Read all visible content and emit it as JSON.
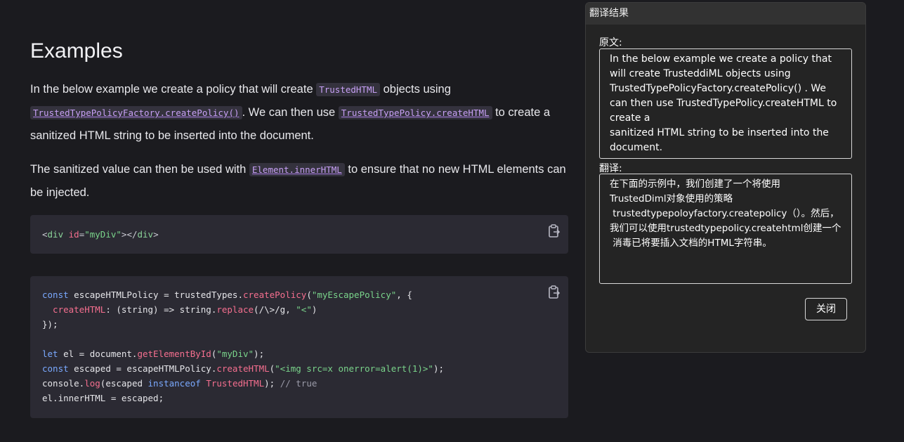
{
  "article": {
    "heading": "Examples",
    "para1": {
      "t1": "In the below example we create a policy that will create ",
      "c1": "TrustedHTML",
      "t2": " objects using ",
      "c2": "TrustedTypePolicyFactory.createPolicy()",
      "t3": ". We can then use ",
      "c3": "TrustedTypePolicy.createHTML",
      "t4": " to create a sanitized HTML string to be inserted into the document."
    },
    "para2": {
      "t1": "The sanitized value can then be used with ",
      "c1": "Element.innerHTML",
      "t2": " to ensure that no new HTML elements can be injected."
    },
    "code1": {
      "lt": "<",
      "tag": "div",
      "attr": "id",
      "eq": "=",
      "val": "\"myDiv\"",
      "close": "></",
      "tag2": "div",
      "gt": ">"
    },
    "code2": {
      "l1_kw": "const",
      "l1_a": " escapeHTMLPolicy = trustedTypes.",
      "l1_fn": "createPolicy",
      "l1_b": "(",
      "l1_str": "\"myEscapePolicy\"",
      "l1_c": ", {",
      "l2_fn": "  createHTML",
      "l2_a": ": (string) => string.",
      "l2_fn2": "replace",
      "l2_b": "(/\\>/g, ",
      "l2_str": "\"<\"",
      "l2_c": ")",
      "l3": "});",
      "l5_kw": "let",
      "l5_a": " el = document.",
      "l5_fn": "getElementById",
      "l5_b": "(",
      "l5_str": "\"myDiv\"",
      "l5_c": ");",
      "l6_kw": "const",
      "l6_a": " escaped = escapeHTMLPolicy.",
      "l6_fn": "createHTML",
      "l6_b": "(",
      "l6_str": "\"<img src=x onerror=alert(1)>\"",
      "l6_c": ");",
      "l7_a": "console.",
      "l7_fn": "log",
      "l7_b": "(escaped ",
      "l7_kw": "instanceof",
      "l7_sp": " ",
      "l7_fn2": "TrustedHTML",
      "l7_c": "); ",
      "l7_cmt": "// true",
      "l8": "el.innerHTML = escaped;"
    }
  },
  "panel": {
    "title": "翻译结果",
    "source_label": "原文:",
    "source_text": "In the below example we create a policy that will create TrusteddiML objects using TrustedTypePolicyFactory.createPolicy() . We can then use TrustedTypePolicy.createHTML to create a\nsanitized HTML string to be inserted into the document.",
    "translation_label": "翻译:",
    "translation_text": "在下面的示例中，我们创建了一个将使用\nTrustedDiml对象使用的策略\n trustedtypepoloyfactory.createpolicy（）。然后，我们可以使用trustedtypepolicy.createhtml创建一个\n 消毒已将要插入文档的HTML字符串。",
    "close_label": "关闭"
  },
  "colors": {
    "page_bg": "#1b1b1f",
    "code_bg": "#2b2a33",
    "inline_code": "#c7a0f5",
    "panel_bg": "#242424"
  },
  "icons": {
    "copy": "clipboard-icon"
  }
}
